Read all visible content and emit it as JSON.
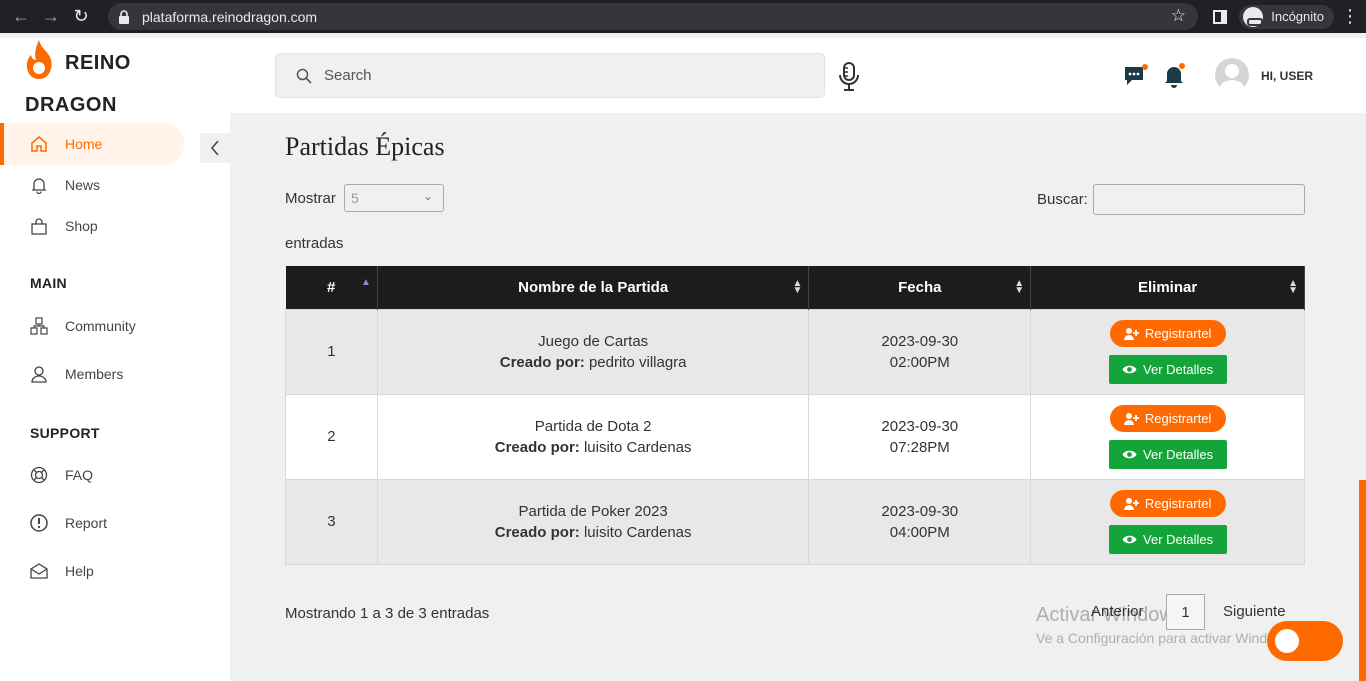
{
  "browser": {
    "url": "plataforma.reinodragon.com",
    "incognito_label": "Incógnito"
  },
  "brand": {
    "line1": "REINO",
    "line2": "DRAGON",
    "accent_color": "#ff6a00"
  },
  "sidebar": {
    "items": [
      {
        "label": "Home",
        "icon": "home-icon",
        "active": true
      },
      {
        "label": "News",
        "icon": "bell-icon"
      },
      {
        "label": "Shop",
        "icon": "bag-icon"
      }
    ],
    "main_title": "MAIN",
    "main_items": [
      {
        "label": "Community",
        "icon": "community-icon"
      },
      {
        "label": "Members",
        "icon": "members-icon"
      }
    ],
    "support_title": "SUPPORT",
    "support_items": [
      {
        "label": "FAQ",
        "icon": "lifebuoy-icon"
      },
      {
        "label": "Report",
        "icon": "alert-circle-icon"
      },
      {
        "label": "Help",
        "icon": "envelope-icon"
      }
    ]
  },
  "header": {
    "search_placeholder": "Search",
    "greeting": "HI, USER"
  },
  "main": {
    "title": "Partidas Épicas",
    "show_label": "Mostrar",
    "show_value": "5",
    "entries_label": "entradas",
    "search_label": "Buscar:"
  },
  "table": {
    "headers": [
      "#",
      "Nombre de la Partida",
      "Fecha",
      "Eliminar"
    ],
    "created_by_label": "Creado por:",
    "register_label": "Registrartel",
    "details_label": "Ver Detalles",
    "rows": [
      {
        "num": "1",
        "name": "Juego de Cartas",
        "creator": "pedrito villagra",
        "date": "2023-09-30",
        "time": "02:00PM"
      },
      {
        "num": "2",
        "name": "Partida de Dota 2",
        "creator": "luisito Cardenas",
        "date": "2023-09-30",
        "time": "07:28PM"
      },
      {
        "num": "3",
        "name": "Partida de Poker 2023",
        "creator": "luisito Cardenas",
        "date": "2023-09-30",
        "time": "04:00PM"
      }
    ]
  },
  "footer": {
    "info": "Mostrando 1 a 3 de 3 entradas",
    "prev": "Anterior",
    "page": "1",
    "next": "Siguiente"
  },
  "watermark": {
    "line1": "Activar Windows",
    "line2": "Ve a Configuración para activar Windows."
  }
}
